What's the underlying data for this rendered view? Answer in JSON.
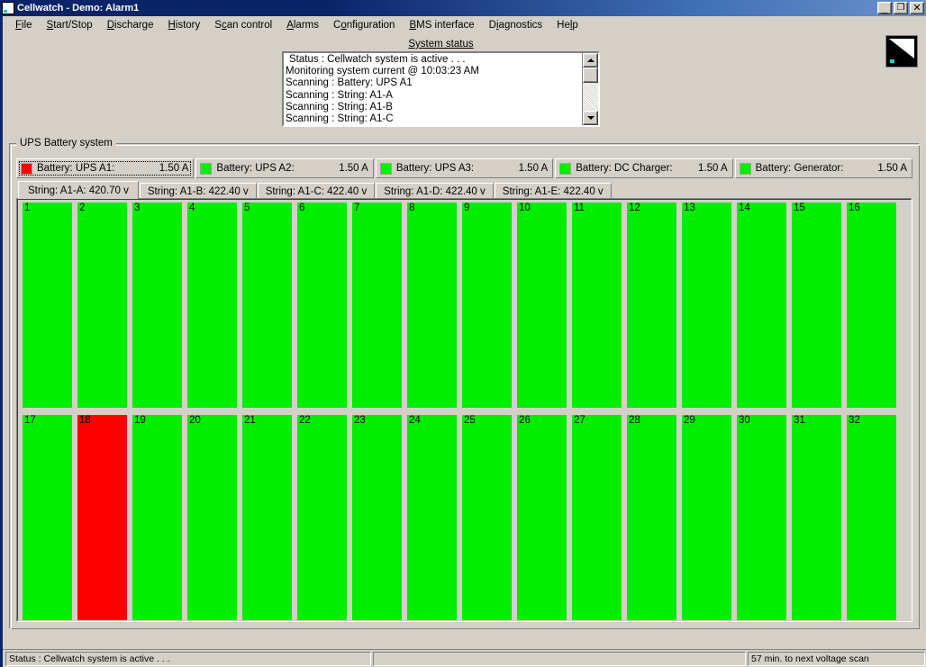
{
  "window": {
    "title": "Cellwatch - Demo: Alarm1",
    "icon": "cellwatch-logo-icon",
    "buttons": {
      "minimize": "_",
      "maximize": "❐",
      "close": "✕"
    }
  },
  "menubar": {
    "items": [
      {
        "label": "File",
        "accel": "F"
      },
      {
        "label": "Start/Stop",
        "accel": "S"
      },
      {
        "label": "Discharge",
        "accel": "D"
      },
      {
        "label": "History",
        "accel": "H"
      },
      {
        "label": "Scan control",
        "accel": "c"
      },
      {
        "label": "Alarms",
        "accel": "A"
      },
      {
        "label": "Configuration",
        "accel": "o"
      },
      {
        "label": "BMS interface",
        "accel": "B"
      },
      {
        "label": "Diagnostics",
        "accel": "i"
      },
      {
        "label": "Help",
        "accel": "l"
      }
    ]
  },
  "system_status": {
    "caption": "System status",
    "lines": [
      "Status : Cellwatch system is active . . .",
      "Monitoring system current @ 10:03:23 AM",
      "Scanning : Battery: UPS A1",
      "Scanning : String: A1-A",
      "Scanning : String: A1-B",
      "Scanning : String: A1-C"
    ],
    "scrollbar": {
      "up_icon": "scroll-up-arrow-icon",
      "down_icon": "scroll-down-arrow-icon"
    }
  },
  "group": {
    "label": "UPS Battery system"
  },
  "battery_tabs": [
    {
      "label": "Battery: UPS A1:",
      "value": "1.50 A",
      "led": "#ff0000",
      "selected": true
    },
    {
      "label": "Battery: UPS A2:",
      "value": "1.50 A",
      "led": "#00ee00",
      "selected": false
    },
    {
      "label": "Battery: UPS A3:",
      "value": "1.50 A",
      "led": "#00ee00",
      "selected": false
    },
    {
      "label": "Battery: DC Charger:",
      "value": "1.50 A",
      "led": "#00ee00",
      "selected": false
    },
    {
      "label": "Battery: Generator:",
      "value": "1.50 A",
      "led": "#00ee00",
      "selected": false
    }
  ],
  "string_tabs": [
    {
      "label": "String: A1-A: 420.70 v",
      "selected": true
    },
    {
      "label": "String: A1-B: 422.40 v",
      "selected": false
    },
    {
      "label": "String: A1-C: 422.40 v",
      "selected": false
    },
    {
      "label": "String: A1-D: 422.40 v",
      "selected": false
    },
    {
      "label": "String: A1-E: 422.40 v",
      "selected": false
    }
  ],
  "colors": {
    "cell_ok": "#00ee00",
    "cell_alarm": "#ff0000",
    "face": "#d4d0c8",
    "title_active": "#0a246a"
  },
  "cells": {
    "rows": [
      [
        {
          "n": "1",
          "state": "ok"
        },
        {
          "n": "2",
          "state": "ok"
        },
        {
          "n": "3",
          "state": "ok"
        },
        {
          "n": "4",
          "state": "ok"
        },
        {
          "n": "5",
          "state": "ok"
        },
        {
          "n": "6",
          "state": "ok"
        },
        {
          "n": "7",
          "state": "ok"
        },
        {
          "n": "8",
          "state": "ok"
        },
        {
          "n": "9",
          "state": "ok"
        },
        {
          "n": "10",
          "state": "ok"
        },
        {
          "n": "11",
          "state": "ok"
        },
        {
          "n": "12",
          "state": "ok"
        },
        {
          "n": "13",
          "state": "ok"
        },
        {
          "n": "14",
          "state": "ok"
        },
        {
          "n": "15",
          "state": "ok"
        },
        {
          "n": "16",
          "state": "ok"
        }
      ],
      [
        {
          "n": "17",
          "state": "ok"
        },
        {
          "n": "18",
          "state": "alarm"
        },
        {
          "n": "19",
          "state": "ok"
        },
        {
          "n": "20",
          "state": "ok"
        },
        {
          "n": "21",
          "state": "ok"
        },
        {
          "n": "22",
          "state": "ok"
        },
        {
          "n": "23",
          "state": "ok"
        },
        {
          "n": "24",
          "state": "ok"
        },
        {
          "n": "25",
          "state": "ok"
        },
        {
          "n": "26",
          "state": "ok"
        },
        {
          "n": "27",
          "state": "ok"
        },
        {
          "n": "28",
          "state": "ok"
        },
        {
          "n": "29",
          "state": "ok"
        },
        {
          "n": "30",
          "state": "ok"
        },
        {
          "n": "31",
          "state": "ok"
        },
        {
          "n": "32",
          "state": "ok"
        }
      ]
    ]
  },
  "statusbar": {
    "left": "Status : Cellwatch system is active . . .",
    "middle": "",
    "right": "57 min. to next voltage scan"
  }
}
